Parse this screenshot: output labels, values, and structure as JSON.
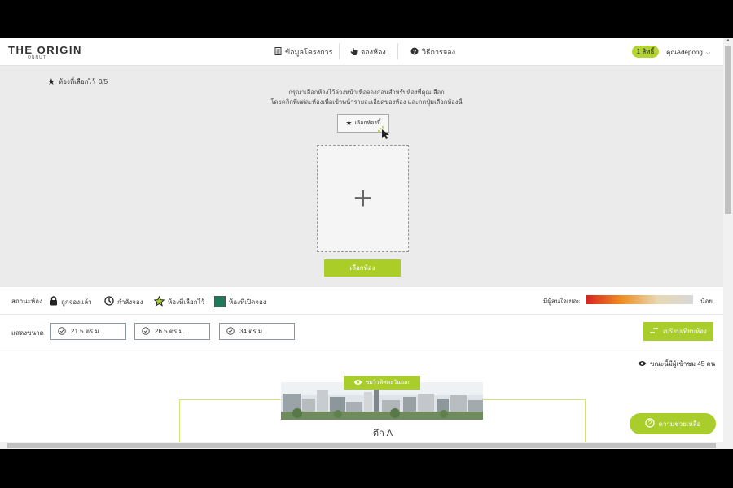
{
  "nav": {
    "logo": "THE ORIGIN",
    "logo_sub": "ONNUT",
    "links": [
      {
        "label": "ข้อมูลโครงการ",
        "icon": "document-icon"
      },
      {
        "label": "จองห้อง",
        "icon": "hand-pointer-icon"
      },
      {
        "label": "วิธีการจอง",
        "icon": "question-icon"
      }
    ],
    "rights_badge": "1 สิทธิ์",
    "user_name": "คุณAdepong"
  },
  "favorites": {
    "label": "ห้องที่เลือกไว้",
    "count": "0/5",
    "instruction_line1": "กรุณาเลือกห้องไว้ล่วงหน้าเพื่อจองก่อนสำหรับห้องที่คุณเลือก",
    "instruction_line2": "โดยคลิกที่แต่ละห้องเพื่อเข้าหน้ารายละเอียดของห้อง และกดปุ่มเลือกห้องนี้",
    "select_room_label": "เลือกห้องนี้",
    "dropzone_symbol": "+",
    "choose_button": "เลือกห้อง"
  },
  "legend": {
    "title": "สถานะห้อง",
    "items": [
      {
        "label": "ถูกจองแล้ว",
        "icon": "lock-icon"
      },
      {
        "label": "กำลังจอง",
        "icon": "clock-icon"
      },
      {
        "label": "ห้องที่เลือกไว้",
        "icon": "star-icon"
      },
      {
        "label": "ห้องที่เปิดจอง",
        "icon": "square-icon"
      }
    ],
    "interest_label": "มีผู้สนใจเยอะ",
    "interest_low": "น้อย"
  },
  "filter": {
    "label": "แสดงขนาด",
    "sizes": [
      "21.5 ตร.ม.",
      "26.5 ตร.ม.",
      "34 ตร.ม."
    ],
    "compare_button": "เปรียบเทียบห้อง"
  },
  "viewers_text": "ขณะนี้มีผู้เข้าชม 45 คน",
  "view_button": "ชมวิวทิศตะวันออก",
  "tower_label": "ตึก A",
  "help_button": "ความช่วยเหลือ",
  "colors": {
    "accent": "#a9cd2a",
    "available": "#1d7a5a",
    "heat_high": "#d9241f",
    "heat_low": "#d8d8d8"
  }
}
